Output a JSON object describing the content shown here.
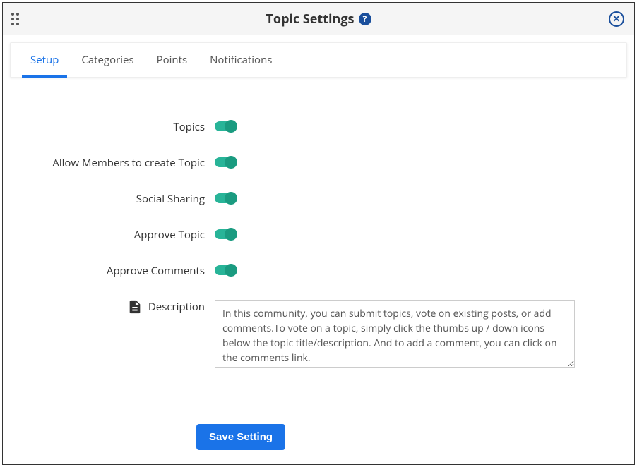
{
  "header": {
    "title": "Topic Settings"
  },
  "tabs": [
    {
      "label": "Setup",
      "active": true
    },
    {
      "label": "Categories",
      "active": false
    },
    {
      "label": "Points",
      "active": false
    },
    {
      "label": "Notifications",
      "active": false
    }
  ],
  "settings": {
    "topics": {
      "label": "Topics",
      "on": true
    },
    "allow_create": {
      "label": "Allow Members to create Topic",
      "on": true
    },
    "social_sharing": {
      "label": "Social Sharing",
      "on": true
    },
    "approve_topic": {
      "label": "Approve Topic",
      "on": true
    },
    "approve_comments": {
      "label": "Approve Comments",
      "on": true
    },
    "description": {
      "label": "Description",
      "value": "In this community, you can submit topics, vote on existing posts, or add comments.To vote on a topic, simply click the thumbs up / down icons below the topic title/description. And to add a comment, you can click on the comments link."
    }
  },
  "actions": {
    "save_label": "Save Setting"
  }
}
